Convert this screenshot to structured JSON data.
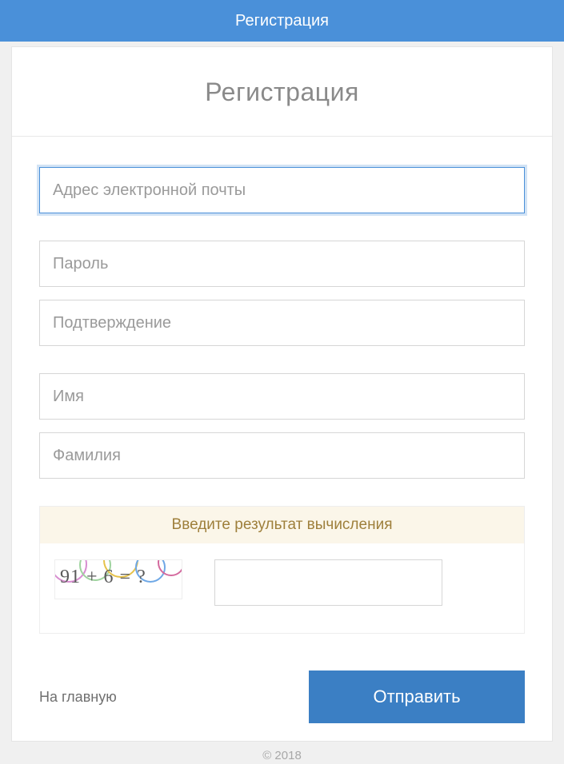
{
  "topbar": {
    "title": "Регистрация"
  },
  "card": {
    "title": "Регистрация"
  },
  "fields": {
    "email": {
      "placeholder": "Адрес электронной почты",
      "value": ""
    },
    "password": {
      "placeholder": "Пароль",
      "value": ""
    },
    "confirm": {
      "placeholder": "Подтверждение",
      "value": ""
    },
    "firstname": {
      "placeholder": "Имя",
      "value": ""
    },
    "lastname": {
      "placeholder": "Фамилия",
      "value": ""
    }
  },
  "captcha": {
    "header": "Введите результат вычисления",
    "expression": "91 + 6 = ?",
    "value": ""
  },
  "footer": {
    "home": "На главную",
    "submit": "Отправить"
  },
  "page_footer_prefix": "© 2018 "
}
